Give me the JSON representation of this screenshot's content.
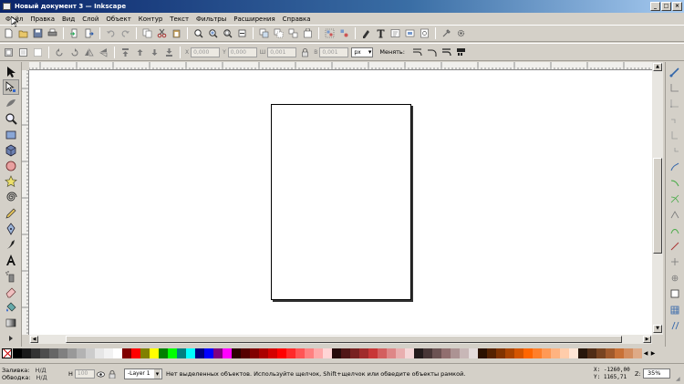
{
  "window": {
    "title": "Новый документ 3 — Inkscape"
  },
  "menu": [
    "Файл",
    "Правка",
    "Вид",
    "Слой",
    "Объект",
    "Контур",
    "Текст",
    "Фильтры",
    "Расширения",
    "Справка"
  ],
  "toolbar2": {
    "x_label": "X",
    "x_value": "0,000",
    "y_label": "Y",
    "y_value": "0,000",
    "w_label": "Ш",
    "w_value": "0,001",
    "h_label": "В",
    "h_value": "0,001",
    "unit": "px",
    "change_label": "Менять:"
  },
  "statusbar": {
    "fill_label": "Заливка:",
    "fill_value": "Н/Д",
    "stroke_label": "Обводка:",
    "stroke_value": "Н/Д",
    "opacity_label": "Н",
    "opacity_value": "100",
    "layer": "-Layer 1",
    "message": "Нет выделенных объектов. Используйте щелчок, Shift+щелчок или обведите объекты рамкой.",
    "x_coord": "X: -1260,00",
    "y_coord": "Y:  1165,71",
    "zoom_label": "Z:",
    "zoom": "35%"
  },
  "palette": {
    "colors": [
      "#000000",
      "#1a1a1a",
      "#333333",
      "#4d4d4d",
      "#666666",
      "#808080",
      "#999999",
      "#b3b3b3",
      "#cccccc",
      "#e6e6e6",
      "#f2f2f2",
      "#ffffff",
      "#800000",
      "#ff0000",
      "#808000",
      "#ffff00",
      "#008000",
      "#00ff00",
      "#008080",
      "#00ffff",
      "#000080",
      "#0000ff",
      "#800080",
      "#ff00ff",
      "#2b0000",
      "#550000",
      "#800000",
      "#aa0000",
      "#d40000",
      "#ff0000",
      "#ff2a2a",
      "#ff5555",
      "#ff8080",
      "#ffaaaa",
      "#ffd5d5",
      "#280b0b",
      "#501616",
      "#782121",
      "#a02c2c",
      "#c83737",
      "#d35f5f",
      "#de8787",
      "#e9afaf",
      "#f4d7d7",
      "#241c1c",
      "#483737",
      "#6c5353",
      "#916f6f",
      "#ac9393",
      "#c8b7b7",
      "#e3dbdb",
      "#2b1100",
      "#552200",
      "#803300",
      "#aa4400",
      "#d45500",
      "#ff6600",
      "#ff7f2a",
      "#ff9955",
      "#ffb380",
      "#ffccaa",
      "#ffe6d5",
      "#28170b",
      "#502d16",
      "#784421",
      "#a05a2c",
      "#c87137",
      "#d38d5f",
      "#deaa87"
    ]
  }
}
